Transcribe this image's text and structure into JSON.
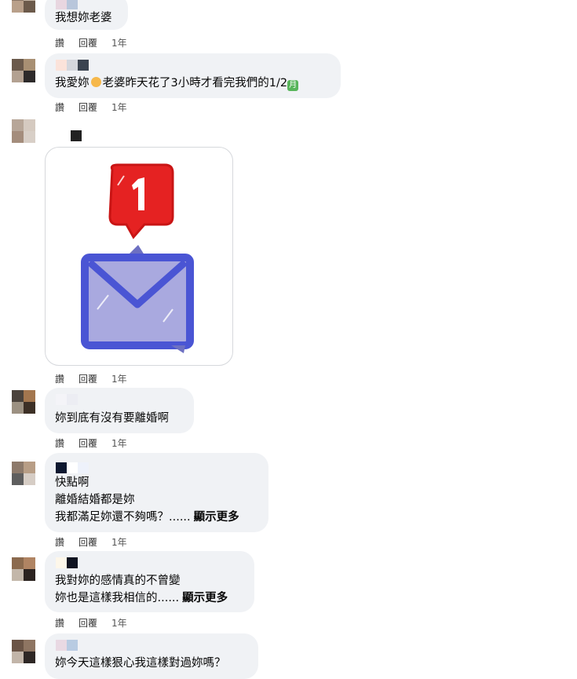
{
  "actions": {
    "like": "讚",
    "reply": "回覆",
    "time": "1年"
  },
  "comments": [
    {
      "lines": [
        "我想妳老婆"
      ]
    },
    {
      "text_before": "我愛妳",
      "text_after": "老婆昨天花了3小時才看完我們的1/2",
      "tail_icon": "月",
      "emoji_icon": "kissing-face-icon"
    },
    {
      "sticker": "notification-envelope-sticker"
    },
    {
      "lines": [
        "妳到底有沒有要離婚啊"
      ]
    },
    {
      "lines": [
        "快點啊",
        "離婚結婚都是妳",
        "我都滿足妳還不夠嗎？......"
      ],
      "more": "顯示更多"
    },
    {
      "lines": [
        "我對妳的感情真的不曾變",
        "妳也是這樣我相信的......"
      ],
      "more": "顯示更多"
    },
    {
      "lines": [
        "妳今天這樣狠心我這樣對過妳嗎？"
      ]
    }
  ],
  "colors": {
    "bubble": "#f0f2f5",
    "sticker_red": "#e52222",
    "sticker_blue": "#4a55d4",
    "envelope_fill": "#a9a9df"
  }
}
